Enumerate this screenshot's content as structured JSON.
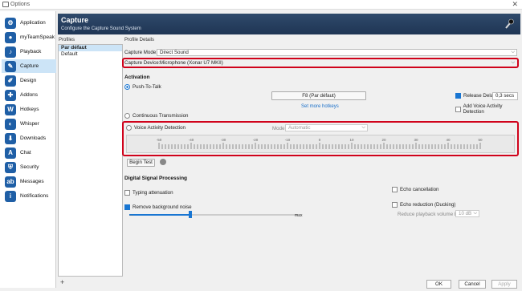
{
  "window": {
    "title": "Options",
    "close": "✕"
  },
  "sidebar": {
    "items": [
      {
        "label": "Application",
        "icon": "gear-icon",
        "color": "#1f5fa6",
        "glyph": "⚙"
      },
      {
        "label": "myTeamSpeak",
        "icon": "user-icon",
        "color": "#1f5fa6",
        "glyph": "●"
      },
      {
        "label": "Playback",
        "icon": "speaker-icon",
        "color": "#1f5fa6",
        "glyph": "♪"
      },
      {
        "label": "Capture",
        "icon": "microphone-icon",
        "color": "#1f5fa6",
        "glyph": "✎"
      },
      {
        "label": "Design",
        "icon": "brush-icon",
        "color": "#1f5fa6",
        "glyph": "✐"
      },
      {
        "label": "Addons",
        "icon": "puzzle-icon",
        "color": "#1f5fa6",
        "glyph": "✚"
      },
      {
        "label": "Hotkeys",
        "icon": "keyboard-icon",
        "color": "#1f5fa6",
        "glyph": "W"
      },
      {
        "label": "Whisper",
        "icon": "whisper-icon",
        "color": "#1f5fa6",
        "glyph": "◐"
      },
      {
        "label": "Downloads",
        "icon": "download-icon",
        "color": "#1f5fa6",
        "glyph": "⬇"
      },
      {
        "label": "Chat",
        "icon": "chat-icon",
        "color": "#1f5fa6",
        "glyph": "A"
      },
      {
        "label": "Security",
        "icon": "shield-icon",
        "color": "#1f5fa6",
        "glyph": "⛨"
      },
      {
        "label": "Messages",
        "icon": "message-icon",
        "color": "#1f5fa6",
        "glyph": "ab"
      },
      {
        "label": "Notifications",
        "icon": "info-icon",
        "color": "#1f5fa6",
        "glyph": "i"
      }
    ],
    "active_index": 3
  },
  "header": {
    "title": "Capture",
    "subtitle": "Configure the Capture Sound System"
  },
  "profiles": {
    "heading": "Profiles",
    "items": [
      "Par défaut",
      "Default"
    ],
    "add": "+"
  },
  "details": {
    "heading": "Profile Details",
    "capture_mode_label": "Capture Mode:",
    "capture_mode_value": "Direct Sound",
    "capture_device_label": "Capture Device:",
    "capture_device_value": "Microphone (Xonar U7 MKII)",
    "activation": {
      "heading": "Activation",
      "ptt_label": "Push-To-Talk",
      "hotkey_button": "F8 (Par défaut)",
      "set_more_hotkeys": "Set more hotkeys",
      "release_delay_label": "Release Delay",
      "release_delay_value": "0,3 secs",
      "add_vad_label": "Add Voice Activity Detection",
      "continuous_label": "Continuous Transmission",
      "vad_label": "Voice Activity Detection",
      "mode_label": "Mode",
      "mode_value": "Automatic",
      "scale": [
        "-50",
        "-40",
        "-30",
        "-20",
        "-10",
        "0",
        "10",
        "20",
        "30",
        "40",
        "50"
      ],
      "begin_test": "Begin Test"
    },
    "dsp": {
      "heading": "Digital Signal Processing",
      "typing_label": "Typing attenuation",
      "remove_noise_label": "Remove background noise",
      "slider_max": "max",
      "echo_cancel_label": "Echo cancellation",
      "echo_reduction_label": "Echo reduction (Ducking)",
      "reduce_volume_label": "Reduce playback volume by:",
      "reduce_volume_value": "10 dB"
    }
  },
  "footer": {
    "ok": "OK",
    "cancel": "Cancel",
    "apply": "Apply"
  },
  "colors": {
    "highlight": "#d0021b",
    "accent": "#1976d2",
    "header": "#2f4a6b"
  }
}
